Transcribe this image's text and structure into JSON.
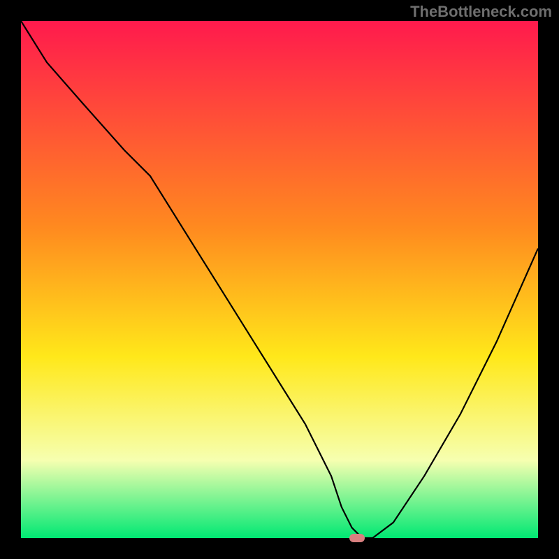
{
  "watermark": "TheBottleneck.com",
  "chart_data": {
    "type": "line",
    "title": "",
    "xlabel": "",
    "ylabel": "",
    "xlim": [
      0,
      100
    ],
    "ylim": [
      0,
      100
    ],
    "background_gradient": {
      "top": "#ff1a4d",
      "mid_upper": "#ff8a1f",
      "mid": "#ffe81a",
      "mid_lower": "#f6ffb0",
      "bottom": "#00e873"
    },
    "series": [
      {
        "name": "bottleneck-curve",
        "color": "#000000",
        "x": [
          0,
          5,
          12,
          20,
          25,
          30,
          35,
          40,
          45,
          50,
          55,
          60,
          62,
          64,
          66,
          68,
          72,
          78,
          85,
          92,
          100
        ],
        "values": [
          100,
          92,
          84,
          75,
          70,
          62,
          54,
          46,
          38,
          30,
          22,
          12,
          6,
          2,
          0,
          0,
          3,
          12,
          24,
          38,
          56
        ]
      }
    ],
    "marker": {
      "x": 65,
      "y": 0,
      "color": "#d98080"
    }
  }
}
